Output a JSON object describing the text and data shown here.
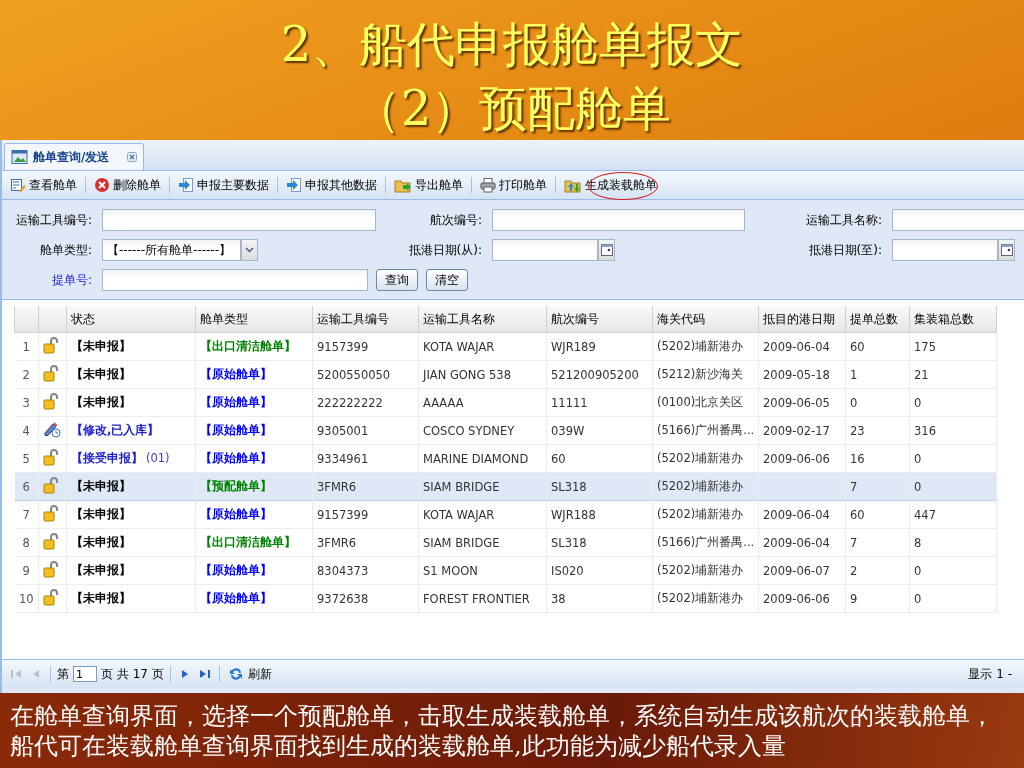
{
  "slide_title": {
    "line_1": "2、船代申报舱单报文",
    "line_2": "（2）预配舱单"
  },
  "tabs": [
    {
      "label": "舱单查询/发送",
      "selected": true,
      "closable": true
    }
  ],
  "toolbar": [
    {
      "label": "查看舱单",
      "kind": "view",
      "circled": false
    },
    {
      "label": "删除舱单",
      "kind": "delete",
      "circled": false
    },
    {
      "label": "申报主要数据",
      "kind": "send",
      "circled": false
    },
    {
      "label": "申报其他数据",
      "kind": "send",
      "circled": false
    },
    {
      "label": "导出舱单",
      "kind": "export",
      "circled": false
    },
    {
      "label": "打印舱单",
      "kind": "print",
      "circled": false
    },
    {
      "label": "生成装载舱单",
      "kind": "generate",
      "circled": true
    }
  ],
  "form": [
    [
      {
        "label": "运输工具编号:",
        "kind": "text",
        "highlight": false
      },
      {
        "label": "航次编号:",
        "kind": "text",
        "highlight": false
      },
      {
        "label": "运输工具名称:",
        "kind": "text",
        "highlight": false
      }
    ],
    [
      {
        "label": "舱单类型:",
        "kind": "select",
        "value": "【------所有舱单------】",
        "highlight": false
      },
      {
        "label": "抵港日期(从):",
        "kind": "date",
        "highlight": false
      },
      {
        "label": "抵港日期(至):",
        "kind": "date",
        "highlight": false
      }
    ],
    [
      {
        "label": "提单号:",
        "kind": "text",
        "highlight": true
      }
    ]
  ],
  "form_buttons": [
    "查询",
    "清空"
  ],
  "grid": {
    "columns": [
      "状态",
      "舱单类型",
      "运输工具编号",
      "运输工具名称",
      "航次编号",
      "海关代码",
      "抵目的港日期",
      "提单总数",
      "集装箱总数"
    ],
    "rows": [
      {
        "no": "1",
        "kind": "lock",
        "status": {
          "text": "【未申报】",
          "color": "#000000"
        },
        "type": {
          "text": "【出口清洁舱单】",
          "color": "#008000"
        },
        "vehicle_no": "9157399",
        "vehicle_name": "KOTA WAJAR",
        "voyage": "WJR189",
        "customs": "(5202)埔新港办",
        "date": "2009-06-04",
        "bills": "60",
        "containers": "175",
        "selected": false
      },
      {
        "no": "2",
        "kind": "lock",
        "status": {
          "text": "【未申报】",
          "color": "#000000"
        },
        "type": {
          "text": "【原始舱单】",
          "color": "#0000ff"
        },
        "vehicle_no": "5200550050",
        "vehicle_name": "JIAN GONG 538",
        "voyage": "521200905200",
        "customs": "(5212)新沙海关",
        "date": "2009-05-18",
        "bills": "1",
        "containers": "21",
        "selected": false
      },
      {
        "no": "3",
        "kind": "lock",
        "status": {
          "text": "【未申报】",
          "color": "#000000"
        },
        "type": {
          "text": "【原始舱单】",
          "color": "#0000ff"
        },
        "vehicle_no": "222222222",
        "vehicle_name": "AAAAA",
        "voyage": "11111",
        "customs": "(0100)北京关区",
        "date": "2009-06-05",
        "bills": "0",
        "containers": "0",
        "selected": false
      },
      {
        "no": "4",
        "kind": "edit",
        "status": {
          "text": "【修改,已入库】",
          "color": "#2020d0"
        },
        "type": {
          "text": "【原始舱单】",
          "color": "#0000ff"
        },
        "vehicle_no": "9305001",
        "vehicle_name": "COSCO SYDNEY",
        "voyage": "039W",
        "customs": "(5166)广州番禺...",
        "date": "2009-02-17",
        "bills": "23",
        "containers": "316",
        "selected": false
      },
      {
        "no": "5",
        "kind": "lock",
        "status": {
          "text": "【接受申报】",
          "color": "#2020d0",
          "code": "(01)"
        },
        "type": {
          "text": "【原始舱单】",
          "color": "#0000ff"
        },
        "vehicle_no": "9334961",
        "vehicle_name": "MARINE DIAMOND",
        "voyage": "60",
        "customs": "(5202)埔新港办",
        "date": "2009-06-06",
        "bills": "16",
        "containers": "0",
        "selected": false
      },
      {
        "no": "6",
        "kind": "lock",
        "status": {
          "text": "【未申报】",
          "color": "#000000"
        },
        "type": {
          "text": "【预配舱单】",
          "color": "#008000"
        },
        "vehicle_no": "3FMR6",
        "vehicle_name": "SIAM BRIDGE",
        "voyage": "SL318",
        "customs": "(5202)埔新港办",
        "bills": "7",
        "containers": "0",
        "selected": true
      },
      {
        "no": "7",
        "kind": "lock",
        "status": {
          "text": "【未申报】",
          "color": "#000000"
        },
        "type": {
          "text": "【原始舱单】",
          "color": "#0000ff"
        },
        "vehicle_no": "9157399",
        "vehicle_name": "KOTA WAJAR",
        "voyage": "WJR188",
        "customs": "(5202)埔新港办",
        "date": "2009-06-04",
        "bills": "60",
        "containers": "447",
        "selected": false
      },
      {
        "no": "8",
        "kind": "lock",
        "status": {
          "text": "【未申报】",
          "color": "#000000"
        },
        "type": {
          "text": "【出口清洁舱单】",
          "color": "#008000"
        },
        "vehicle_no": "3FMR6",
        "vehicle_name": "SIAM BRIDGE",
        "voyage": "SL318",
        "customs": "(5166)广州番禺...",
        "date": "2009-06-04",
        "bills": "7",
        "containers": "8",
        "selected": false
      },
      {
        "no": "9",
        "kind": "lock",
        "status": {
          "text": "【未申报】",
          "color": "#000000"
        },
        "type": {
          "text": "【原始舱单】",
          "color": "#0000ff"
        },
        "vehicle_no": "8304373",
        "vehicle_name": "S1 MOON",
        "voyage": "IS020",
        "customs": "(5202)埔新港办",
        "date": "2009-06-07",
        "bills": "2",
        "containers": "0",
        "selected": false
      },
      {
        "no": "10",
        "kind": "lock",
        "status": {
          "text": "【未申报】",
          "color": "#000000"
        },
        "type": {
          "text": "【原始舱单】",
          "color": "#0000ff"
        },
        "vehicle_no": "9372638",
        "vehicle_name": "FOREST FRONTIER",
        "voyage": "38",
        "customs": "(5202)埔新港办",
        "date": "2009-06-06",
        "bills": "9",
        "containers": "0",
        "selected": false
      }
    ]
  },
  "pager": {
    "nav_before": [
      {
        "kind": "first",
        "disabled": true
      },
      {
        "kind": "prev",
        "disabled": true
      }
    ],
    "page_prefix": "第",
    "page": "1",
    "page_suffix": "页 共 17 页",
    "nav_after": [
      {
        "kind": "next",
        "disabled": false
      },
      {
        "kind": "last",
        "disabled": false
      }
    ],
    "refresh": "刷新",
    "display": "显示 1 -"
  },
  "caption": "在舱单查询界面，选择一个预配舱单，击取生成装载舱单，系统自动生成该航次的装载舱单，船代可在装载舱单查询界面找到生成的装载舱单,此功能为减少船代录入量"
}
